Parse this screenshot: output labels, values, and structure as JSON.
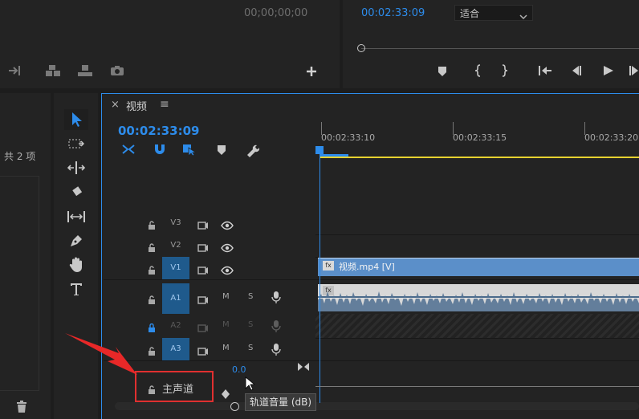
{
  "source_monitor": {
    "timecode": "00;00;00;00"
  },
  "program_monitor": {
    "timecode": "00:02:33:09",
    "fit_label": "适合"
  },
  "project_panel": {
    "item_count": "共 2 项"
  },
  "timeline": {
    "tab_title": "视频",
    "close_symbol": "×",
    "menu_symbol": "≡",
    "timecode": "00:02:33:09",
    "ruler": [
      "00:02:33:10",
      "00:02:33:15",
      "00:02:33:20"
    ],
    "video_tracks": [
      {
        "name": "V3",
        "selected": false
      },
      {
        "name": "V2",
        "selected": false
      },
      {
        "name": "V1",
        "selected": true
      }
    ],
    "audio_tracks": [
      {
        "name": "A1",
        "selected": true,
        "m": "M",
        "s": "S"
      },
      {
        "name": "A2",
        "selected": false,
        "m": "M",
        "s": "S"
      },
      {
        "name": "A3",
        "selected": true,
        "m": "M",
        "s": "S"
      }
    ],
    "clip_label": "视频.mp4 [V]",
    "fx_badge": "fx",
    "master_label": "主声道",
    "master_value": "0.0",
    "tooltip": "轨道音量 (dB)"
  },
  "colors": {
    "accent_blue": "#2d8ceb",
    "highlight_red": "#e03030",
    "clip_blue": "#5b8fc9"
  }
}
